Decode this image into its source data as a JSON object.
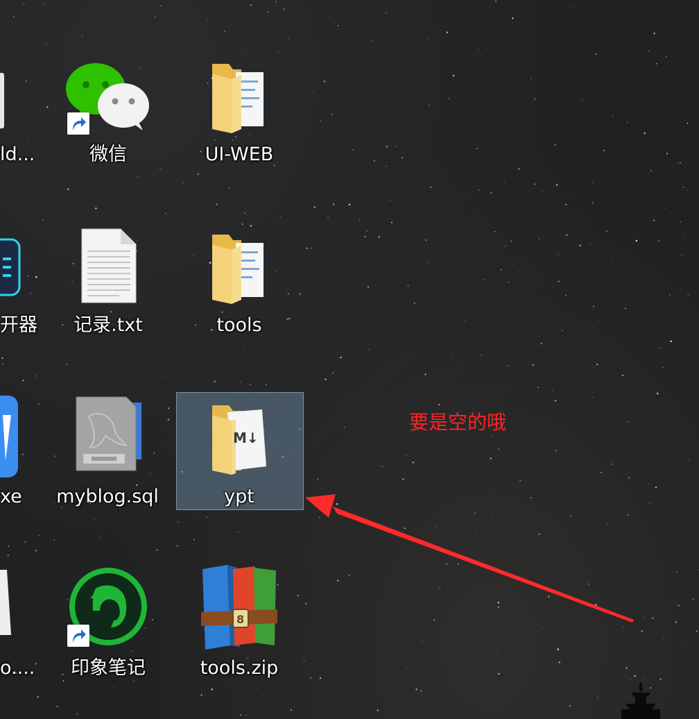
{
  "desktop": {
    "items": [
      {
        "label": "ld..."
      },
      {
        "label": "微信"
      },
      {
        "label": "UI-WEB"
      },
      {
        "label": "开器"
      },
      {
        "label": "记录.txt"
      },
      {
        "label": "tools"
      },
      {
        "label": "xe"
      },
      {
        "label": "myblog.sql"
      },
      {
        "label": "ypt"
      },
      {
        "label": "o...."
      },
      {
        "label": "印象笔记"
      },
      {
        "label": "tools.zip"
      }
    ],
    "md_badge": "M↓",
    "winrar_clasp": "8"
  },
  "annotation": {
    "text": "要是空的哦",
    "color": "#ff2323"
  }
}
